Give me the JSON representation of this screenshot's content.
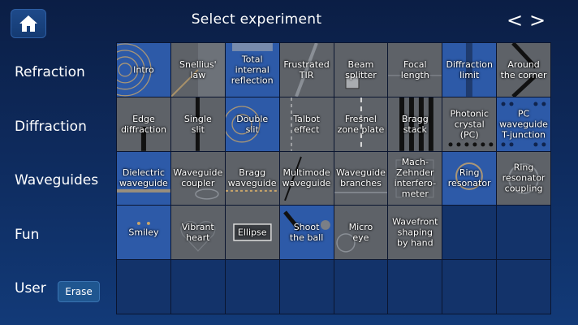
{
  "header": {
    "title": "Select experiment",
    "prev": "<",
    "next": ">"
  },
  "rows": {
    "refraction": "Refraction",
    "diffraction": "Diffraction",
    "waveguides": "Waveguides",
    "fun": "Fun",
    "user": "User"
  },
  "erase_label": "Erase",
  "tiles": {
    "intro": "Intro",
    "snellius": "Snellius'\nlaw",
    "tir": "Total\ninternal\nreflection",
    "ftir": "Frustrated\nTIR",
    "beam_splitter": "Beam\nsplitter",
    "focal_length": "Focal\nlength",
    "diffraction_limit": "Diffraction\nlimit",
    "around_corner": "Around\nthe corner",
    "edge_diffraction": "Edge\ndiffraction",
    "single_slit": "Single\nslit",
    "double_slit": "Double\nslit",
    "talbot": "Talbot\neffect",
    "fresnel": "Fresnel\nzone plate",
    "bragg_stack": "Bragg\nstack",
    "photonic_crystal": "Photonic\ncrystal\n(PC)",
    "pc_waveguide": "PC\nwaveguide\nT-junction",
    "dielectric_waveguide": "Dielectric\nwaveguide",
    "waveguide_coupler": "Waveguide\ncoupler",
    "bragg_waveguide": "Bragg\nwaveguide",
    "multimode": "Multimode\nwaveguide",
    "waveguide_branches": "Waveguide\nbranches",
    "mach_zehnder": "Mach-\nZehnder\ninterfero-\nmeter",
    "ring_resonator": "Ring\nresonator",
    "ring_coupling": "Ring\nresonator\ncoupling",
    "smiley": "Smiley",
    "vibrant_heart": "Vibrant\nheart",
    "ellipse": "Ellipse",
    "shoot_ball": "Shoot\nthe ball",
    "micro_eye": "Micro\neye",
    "wavefront": "Wavefront\nshaping\nby hand"
  }
}
